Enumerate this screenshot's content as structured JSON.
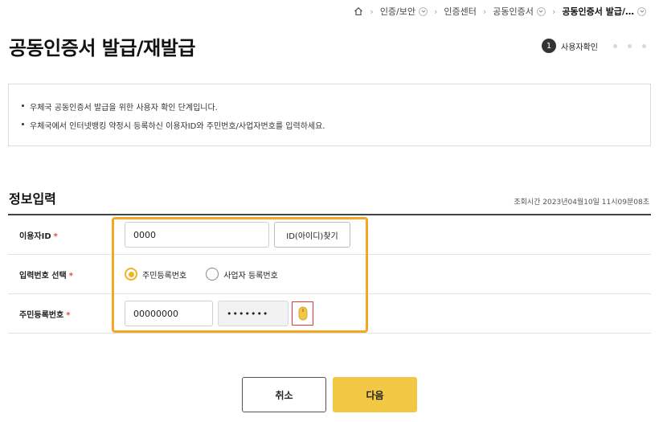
{
  "breadcrumb": {
    "items": [
      "인증/보안",
      "인증센터",
      "공동인증서",
      "공동인증서 발급/…"
    ]
  },
  "page_title": "공동인증서 발급/재발급",
  "stepper": {
    "current_step": "1",
    "current_label": "사용자확인"
  },
  "notice": {
    "lines": [
      "우체국 공동인증서 발급을 위한 사용자 확인 단계입니다.",
      "우체국에서 인터넷뱅킹 약정시 등록하신 이용자ID와 주민번호/사업자번호를 입력하세요."
    ]
  },
  "section": {
    "title": "정보입력",
    "inquiry_time": "조회시간 2023년04월10일 11시09분08초"
  },
  "form": {
    "userid_label": "이용자ID",
    "userid_value": "0000",
    "find_id_button": "ID(아이디)찾기",
    "number_type_label": "입력번호 선택",
    "radio_options": [
      "주민등록번호",
      "사업자 등록번호"
    ],
    "selected_option": "주민등록번호",
    "rrn_label": "주민등록번호",
    "rrn_front": "00000000",
    "rrn_back_masked": "•••••••",
    "required_mark": "*"
  },
  "actions": {
    "cancel": "취소",
    "next": "다음"
  },
  "colors": {
    "accent": "#f2c744",
    "radio_checked": "#f0b429",
    "highlight_border": "#f5a623",
    "required": "#e64a3b"
  }
}
